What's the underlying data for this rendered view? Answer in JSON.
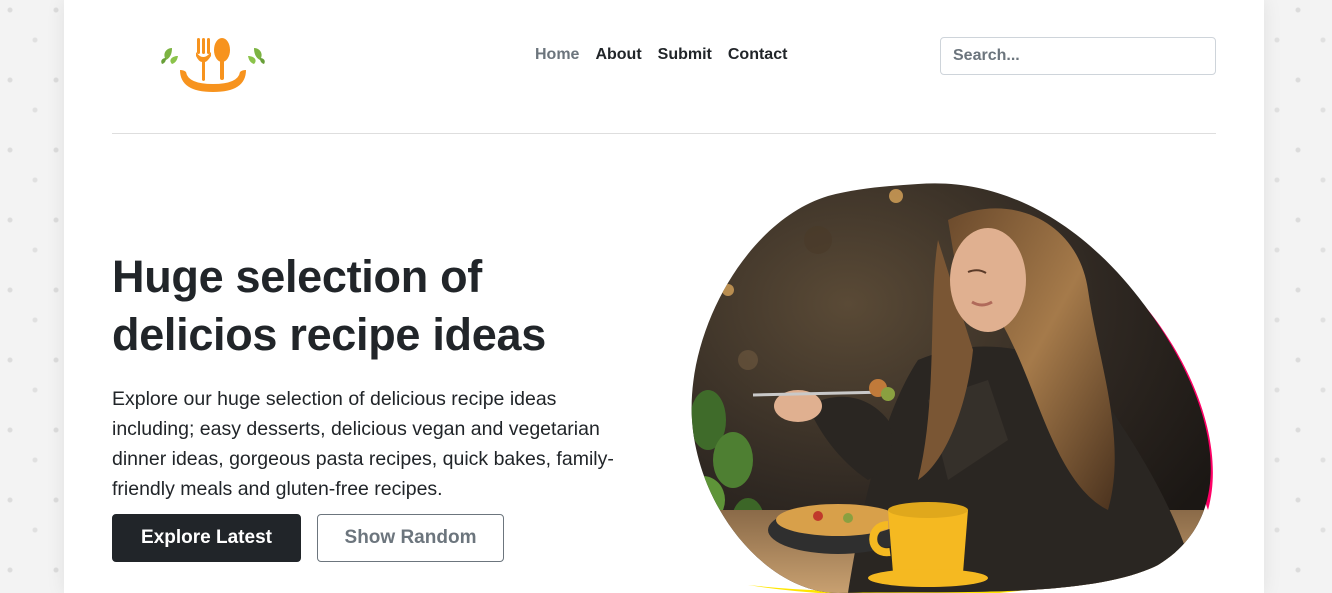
{
  "header": {
    "logo_icon": "fork-spoon-smile-logo",
    "nav": [
      {
        "label": "Home",
        "active": true
      },
      {
        "label": "About",
        "active": false
      },
      {
        "label": "Submit",
        "active": false
      },
      {
        "label": "Contact",
        "active": false
      }
    ],
    "search": {
      "placeholder": "Search...",
      "value": ""
    }
  },
  "hero": {
    "title_line1": "Huge selection of",
    "title_line2": "delicios recipe ideas",
    "lead": "Explore our huge selection of delicious recipe ideas including; easy desserts, delicious vegan and vegetarian dinner ideas, gorgeous pasta recipes, quick bakes, family-friendly meals and gluten-free recipes.",
    "buttons": {
      "explore": "Explore Latest",
      "random": "Show Random"
    },
    "image_subject": "woman-eating-pasta-photo"
  },
  "colors": {
    "logo_orange": "#f7931e",
    "logo_leaf": "#7cb342",
    "accent_pink": "#ff0066",
    "accent_yellow": "#ffe600",
    "text_dark": "#212529",
    "muted": "#6c757d"
  }
}
